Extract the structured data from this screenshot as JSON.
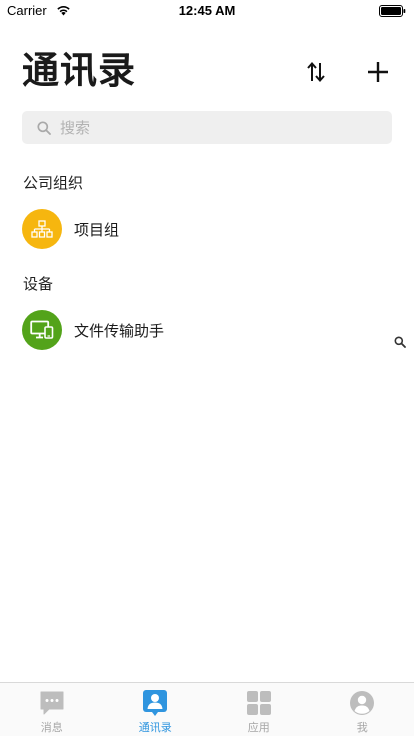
{
  "status_bar": {
    "carrier": "Carrier",
    "time": "12:45 AM"
  },
  "header": {
    "title": "通讯录"
  },
  "search": {
    "placeholder": "搜索",
    "value": ""
  },
  "sections": {
    "organization": {
      "title": "公司组织",
      "items": [
        {
          "label": "项目组",
          "icon": "org-chart-icon",
          "color": "#f6b60f"
        }
      ]
    },
    "devices": {
      "title": "设备",
      "items": [
        {
          "label": "文件传输助手",
          "icon": "monitor-icon",
          "color": "#53a31a"
        }
      ]
    }
  },
  "tab_bar": {
    "tabs": [
      {
        "label": "消息",
        "icon": "chat-bubble-icon",
        "active": false
      },
      {
        "label": "通讯录",
        "icon": "contacts-icon",
        "active": true
      },
      {
        "label": "应用",
        "icon": "apps-grid-icon",
        "active": false
      },
      {
        "label": "我",
        "icon": "profile-icon",
        "active": false
      }
    ]
  },
  "colors": {
    "accent": "#2f95df",
    "inactive": "#a6a6a6",
    "org_icon_bg": "#f6b60f",
    "device_icon_bg": "#53a31a",
    "search_bg": "#efefef"
  }
}
